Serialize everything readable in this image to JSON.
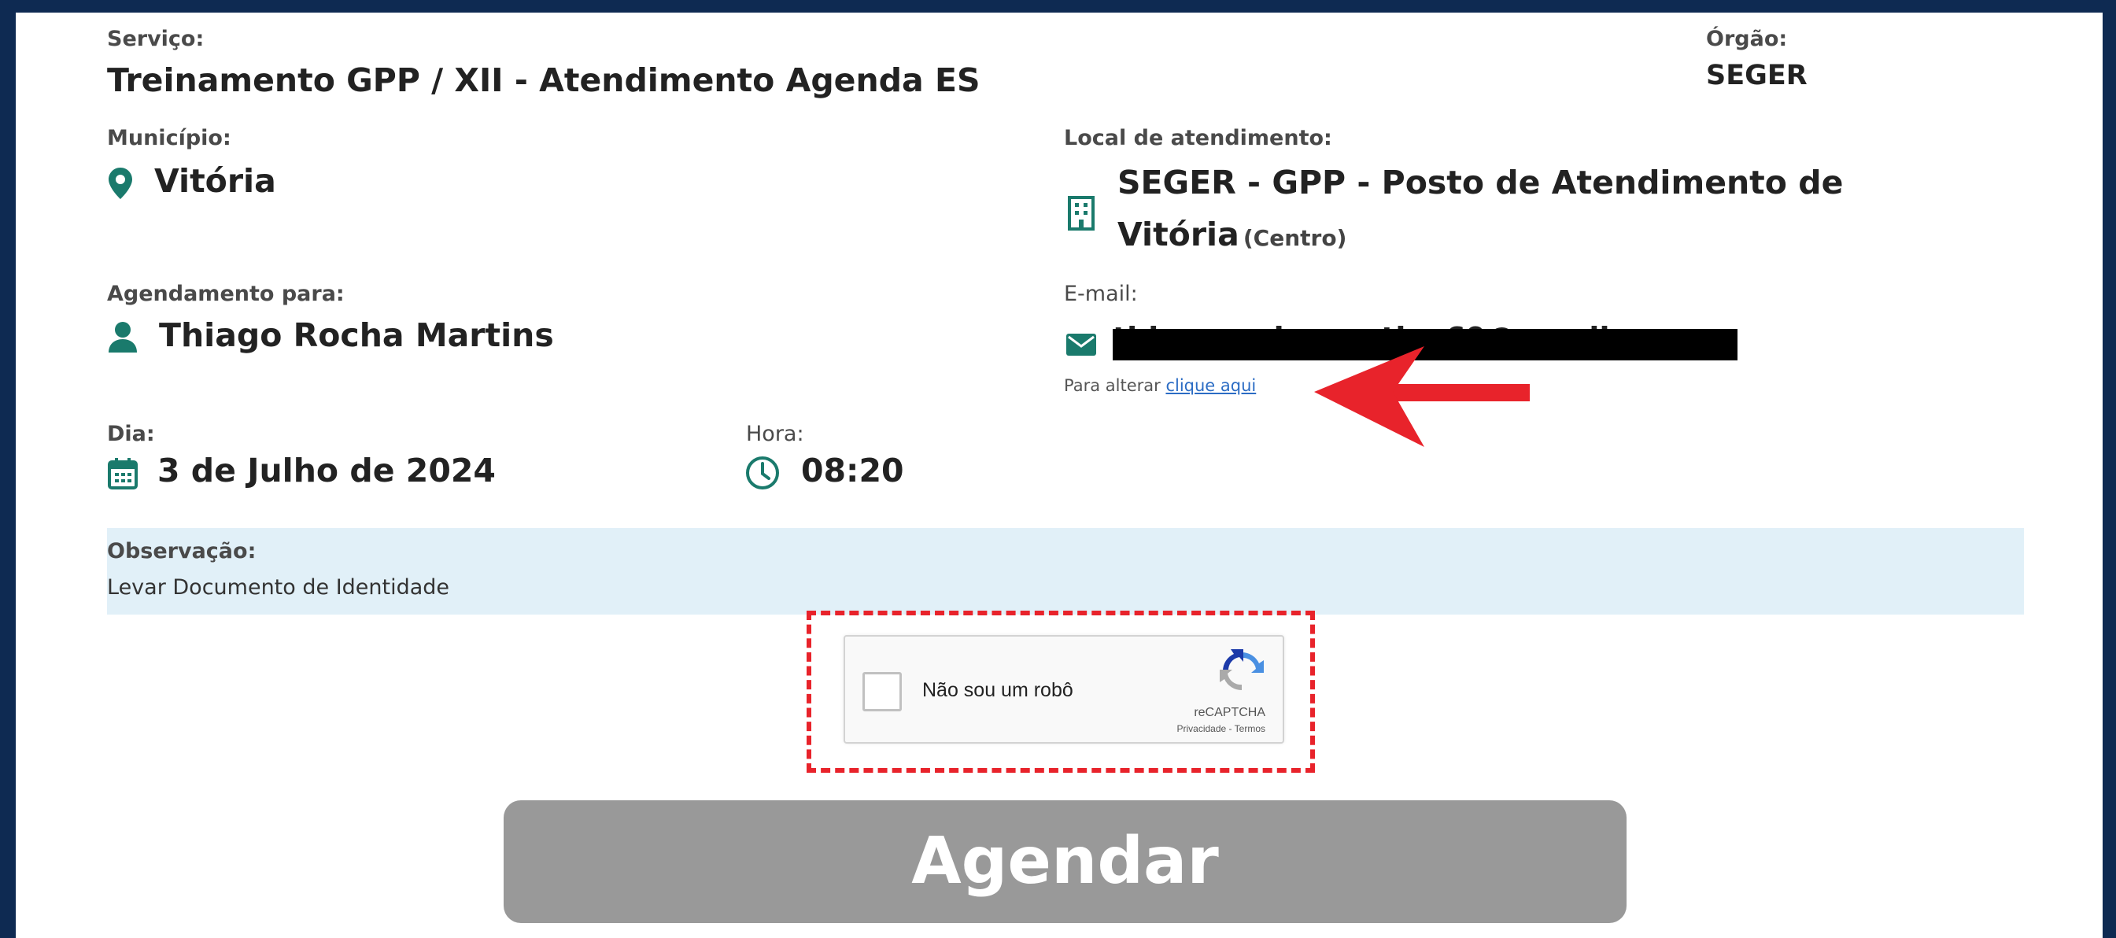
{
  "service": {
    "label": "Serviço:",
    "value": "Treinamento GPP / XII - Atendimento Agenda ES"
  },
  "organ": {
    "label": "Órgão:",
    "value": "SEGER"
  },
  "municipality": {
    "label": "Município:",
    "value": "Vitória",
    "icon": "map-pin-icon"
  },
  "location": {
    "label": "Local de atendimento:",
    "line1": "SEGER - GPP - Posto de Atendimento de",
    "line2": "Vitória",
    "neighborhood": "(Centro)",
    "icon": "building-icon"
  },
  "scheduled_for": {
    "label": "Agendamento para:",
    "value": "Thiago Rocha Martins",
    "icon": "user-icon"
  },
  "email": {
    "label": "E-mail:",
    "value": "thiagorochamartins69@gmail.com",
    "change_prefix": "Para alterar",
    "change_link": "clique aqui",
    "icon": "envelope-icon"
  },
  "date": {
    "label": "Dia:",
    "value": "3 de Julho de 2024",
    "icon": "calendar-icon"
  },
  "time": {
    "label": "Hora:",
    "value": "08:20",
    "icon": "clock-icon"
  },
  "note": {
    "label": "Observação:",
    "value": "Levar Documento de Identidade"
  },
  "captcha": {
    "label": "Não sou um robô",
    "brand": "reCAPTCHA",
    "links": "Privacidade - Termos"
  },
  "submit": {
    "label": "Agendar"
  },
  "colors": {
    "accent": "#1a7a6c",
    "frame": "#0e2a52",
    "annotation": "#e8232b",
    "button": "#999999"
  }
}
